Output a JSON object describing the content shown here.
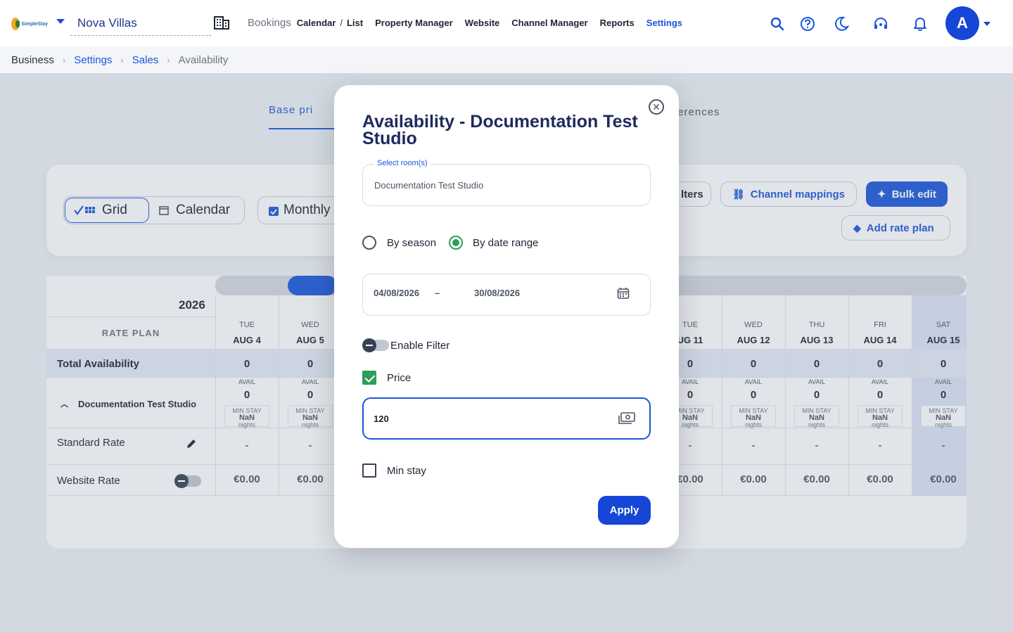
{
  "nav": {
    "logo_text": "SimpleStay",
    "property": "Nova Villas",
    "bookings": "Bookings",
    "calendar": "Calendar",
    "sep": "/",
    "list": "List",
    "links": [
      "Property Manager",
      "Website",
      "Channel Manager",
      "Reports",
      "Settings"
    ],
    "avatar": "A"
  },
  "breadcrumb": [
    "Business",
    "Settings",
    "Sales",
    "Availability"
  ],
  "subtabs": {
    "left": "Base pri",
    "right": "ferences"
  },
  "toolbar": {
    "grid": "Grid",
    "calendar": "Calendar",
    "monthly": "Monthly",
    "filters": "lters",
    "channel_mappings": "Channel mappings",
    "bulk_edit": "Bulk edit",
    "add_rate_plan": "Add rate plan"
  },
  "grid": {
    "year": "2026",
    "rate_plan_header": "RATE PLAN",
    "total_label": "Total Availability",
    "room_label": "Documentation Test Studio",
    "rates": [
      "Standard Rate",
      "Website Rate"
    ],
    "avail_label": "AVAIL",
    "minstay_label": "MIN STAY",
    "minstay_value": "NaN",
    "minstay_unit": "nights",
    "columns": [
      {
        "dow": "TUE",
        "date": "AUG 4",
        "total": "0",
        "avail": "0",
        "standard": "-",
        "website": "€0.00"
      },
      {
        "dow": "WED",
        "date": "AUG 5",
        "total": "0",
        "avail": "0",
        "standard": "-",
        "website": "€0.00"
      },
      {
        "dow": "TUE",
        "date": "UG 11",
        "total": "0",
        "avail": "0",
        "standard": "-",
        "website": "€0.00"
      },
      {
        "dow": "WED",
        "date": "AUG 12",
        "total": "0",
        "avail": "0",
        "standard": "-",
        "website": "€0.00"
      },
      {
        "dow": "THU",
        "date": "AUG 13",
        "total": "0",
        "avail": "0",
        "standard": "-",
        "website": "€0.00"
      },
      {
        "dow": "FRI",
        "date": "AUG 14",
        "total": "0",
        "avail": "0",
        "standard": "-",
        "website": "€0.00"
      },
      {
        "dow": "SAT",
        "date": "AUG 15",
        "total": "0",
        "avail": "0",
        "standard": "-",
        "website": "€0.00"
      }
    ]
  },
  "modal": {
    "title": "Availability - Documentation Test Studio",
    "room_label": "Select room(s)",
    "room_value": "Documentation Test Studio",
    "by_season": "By season",
    "by_date_range": "By date range",
    "date_from": "04/08/2026",
    "date_sep": "–",
    "date_to": "30/08/2026",
    "enable_filter": "Enable Filter",
    "price_label": "Price",
    "price_value": "120",
    "min_stay": "Min stay",
    "apply": "Apply"
  },
  "colors": {
    "accent": "#1a56db",
    "success": "#2e9e5b",
    "title": "#1e2a5e"
  }
}
